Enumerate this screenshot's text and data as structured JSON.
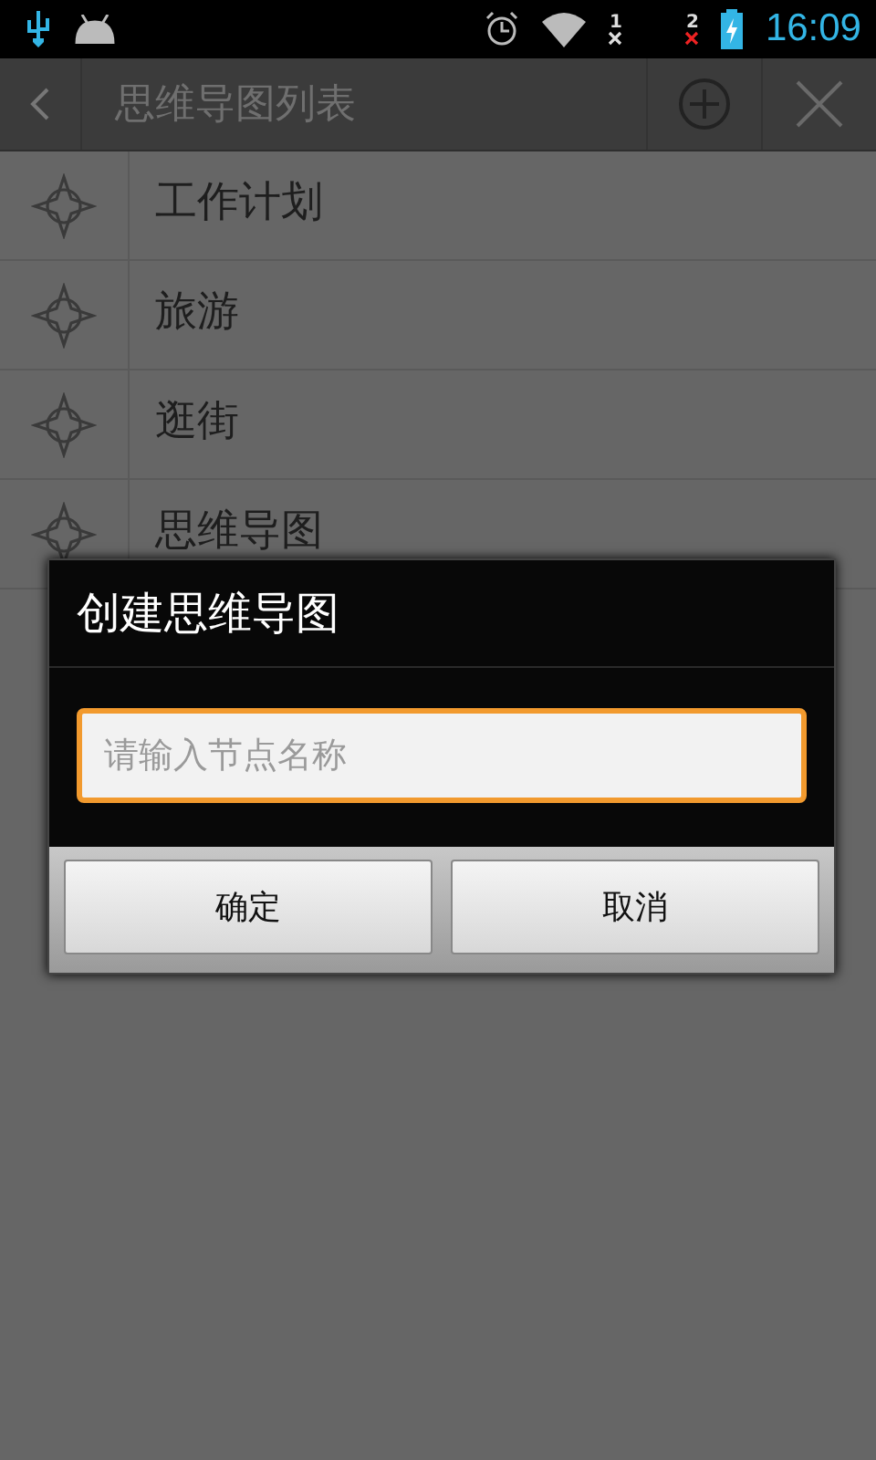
{
  "status_bar": {
    "sim_1": "1",
    "sim_2": "2",
    "time": "16:09"
  },
  "toolbar": {
    "title": "思维导图列表"
  },
  "list": {
    "items": [
      {
        "label": "工作计划"
      },
      {
        "label": "旅游"
      },
      {
        "label": "逛街"
      },
      {
        "label": "思维导图"
      }
    ]
  },
  "dialog": {
    "title": "创建思维导图",
    "input": {
      "placeholder": "请输入节点名称",
      "focused": true
    },
    "buttons": [
      {
        "label": "确定"
      },
      {
        "label": "取消"
      }
    ]
  }
}
